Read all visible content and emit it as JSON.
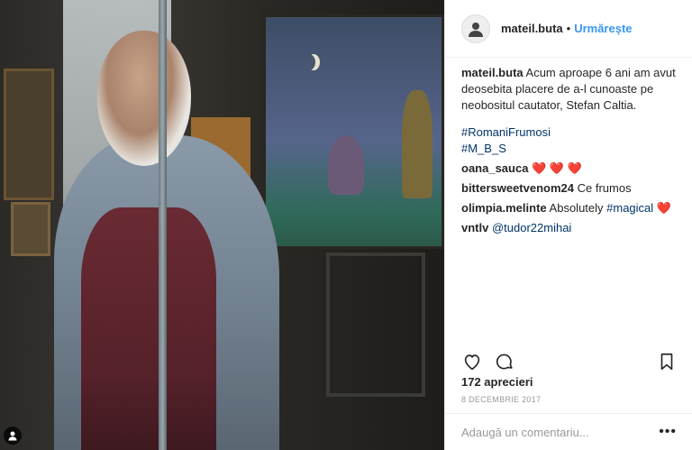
{
  "photo": {
    "user_badge_icon": "person-icon"
  },
  "header": {
    "username": "mateil.buta",
    "separator": "•",
    "follow_label": "Urmărește",
    "avatar_icon": "profile-avatar-icon"
  },
  "caption": {
    "username": "mateil.buta",
    "text": "Acum aproape 6 ani am avut deosebita placere de a-l cunoaste pe neobositul cautator, Stefan Caltia.",
    "hashtags": [
      "#RomaniFrumosi",
      "#M_B_S"
    ]
  },
  "comments": [
    {
      "username": "oana_sauca",
      "text": "❤️ ❤️ ❤️"
    },
    {
      "username": "bittersweetvenom24",
      "text": "Ce frumos"
    },
    {
      "username": "olimpia.melinte",
      "text": "Absolutely ",
      "tag": "#magical",
      "suffix": " ❤️"
    },
    {
      "username": "vntlv",
      "tag": "@tudor22mihai"
    }
  ],
  "actions": {
    "like_icon": "heart-icon",
    "comment_icon": "comment-bubble-icon",
    "save_icon": "bookmark-icon"
  },
  "likes": "172 aprecieri",
  "date": "8 DECEMBRIE 2017",
  "comment_bar": {
    "placeholder": "Adaugă un comentariu...",
    "more_label": "•••"
  },
  "colors": {
    "accent": "#3897f0",
    "link": "#003569",
    "heart": "#ed4956"
  }
}
